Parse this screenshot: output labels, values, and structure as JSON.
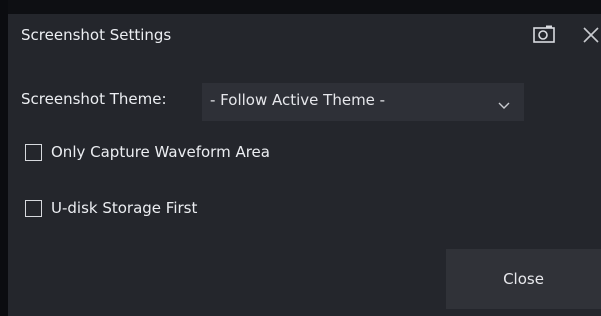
{
  "dialog": {
    "title": "Screenshot Settings",
    "camera_icon": "camera-icon",
    "close_icon": "close-icon"
  },
  "theme": {
    "label": "Screenshot Theme:",
    "selected": "- Follow Active Theme -",
    "dropdown_icon": "chevron-down-icon"
  },
  "options": [
    {
      "label": "Only Capture Waveform Area",
      "checked": false
    },
    {
      "label": "U-disk Storage First",
      "checked": false
    }
  ],
  "footer": {
    "close_label": "Close"
  },
  "colors": {
    "dialog_bg": "#24262c",
    "select_bg": "#2e3037",
    "button_bg": "#303238",
    "text": "#eceef2"
  }
}
